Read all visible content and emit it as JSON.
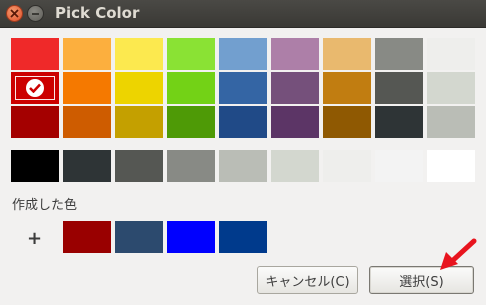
{
  "window": {
    "title": "Pick Color"
  },
  "palette": {
    "rows": [
      [
        "#ef2929",
        "#fcaf3e",
        "#fce94f",
        "#8ae234",
        "#729fcf",
        "#ad7fa8",
        "#e9b96e",
        "#888a85",
        "#eeeeec"
      ],
      [
        "#cc0000",
        "#f57900",
        "#edd400",
        "#73d216",
        "#3465a4",
        "#75507b",
        "#c17d11",
        "#555753",
        "#d3d7cf"
      ],
      [
        "#a40000",
        "#ce5c00",
        "#c4a000",
        "#4e9a06",
        "#204a87",
        "#5c3566",
        "#8f5902",
        "#2e3436",
        "#babdb6"
      ]
    ],
    "selected": "#cc0000",
    "grays": [
      "#000000",
      "#2e3436",
      "#555753",
      "#888a85",
      "#babdb6",
      "#d3d7cf",
      "#eeeeec",
      "#f3f3f3",
      "#ffffff"
    ]
  },
  "custom": {
    "label": "作成した色",
    "add_glyph": "+",
    "colors": [
      "#990000",
      "#2c4a6e",
      "#0000ff",
      "#003a8c"
    ]
  },
  "buttons": {
    "cancel_label": "キャンセル(C)",
    "select_label": "選択(S)"
  },
  "annotation": {
    "arrow_color": "#e8141e"
  }
}
